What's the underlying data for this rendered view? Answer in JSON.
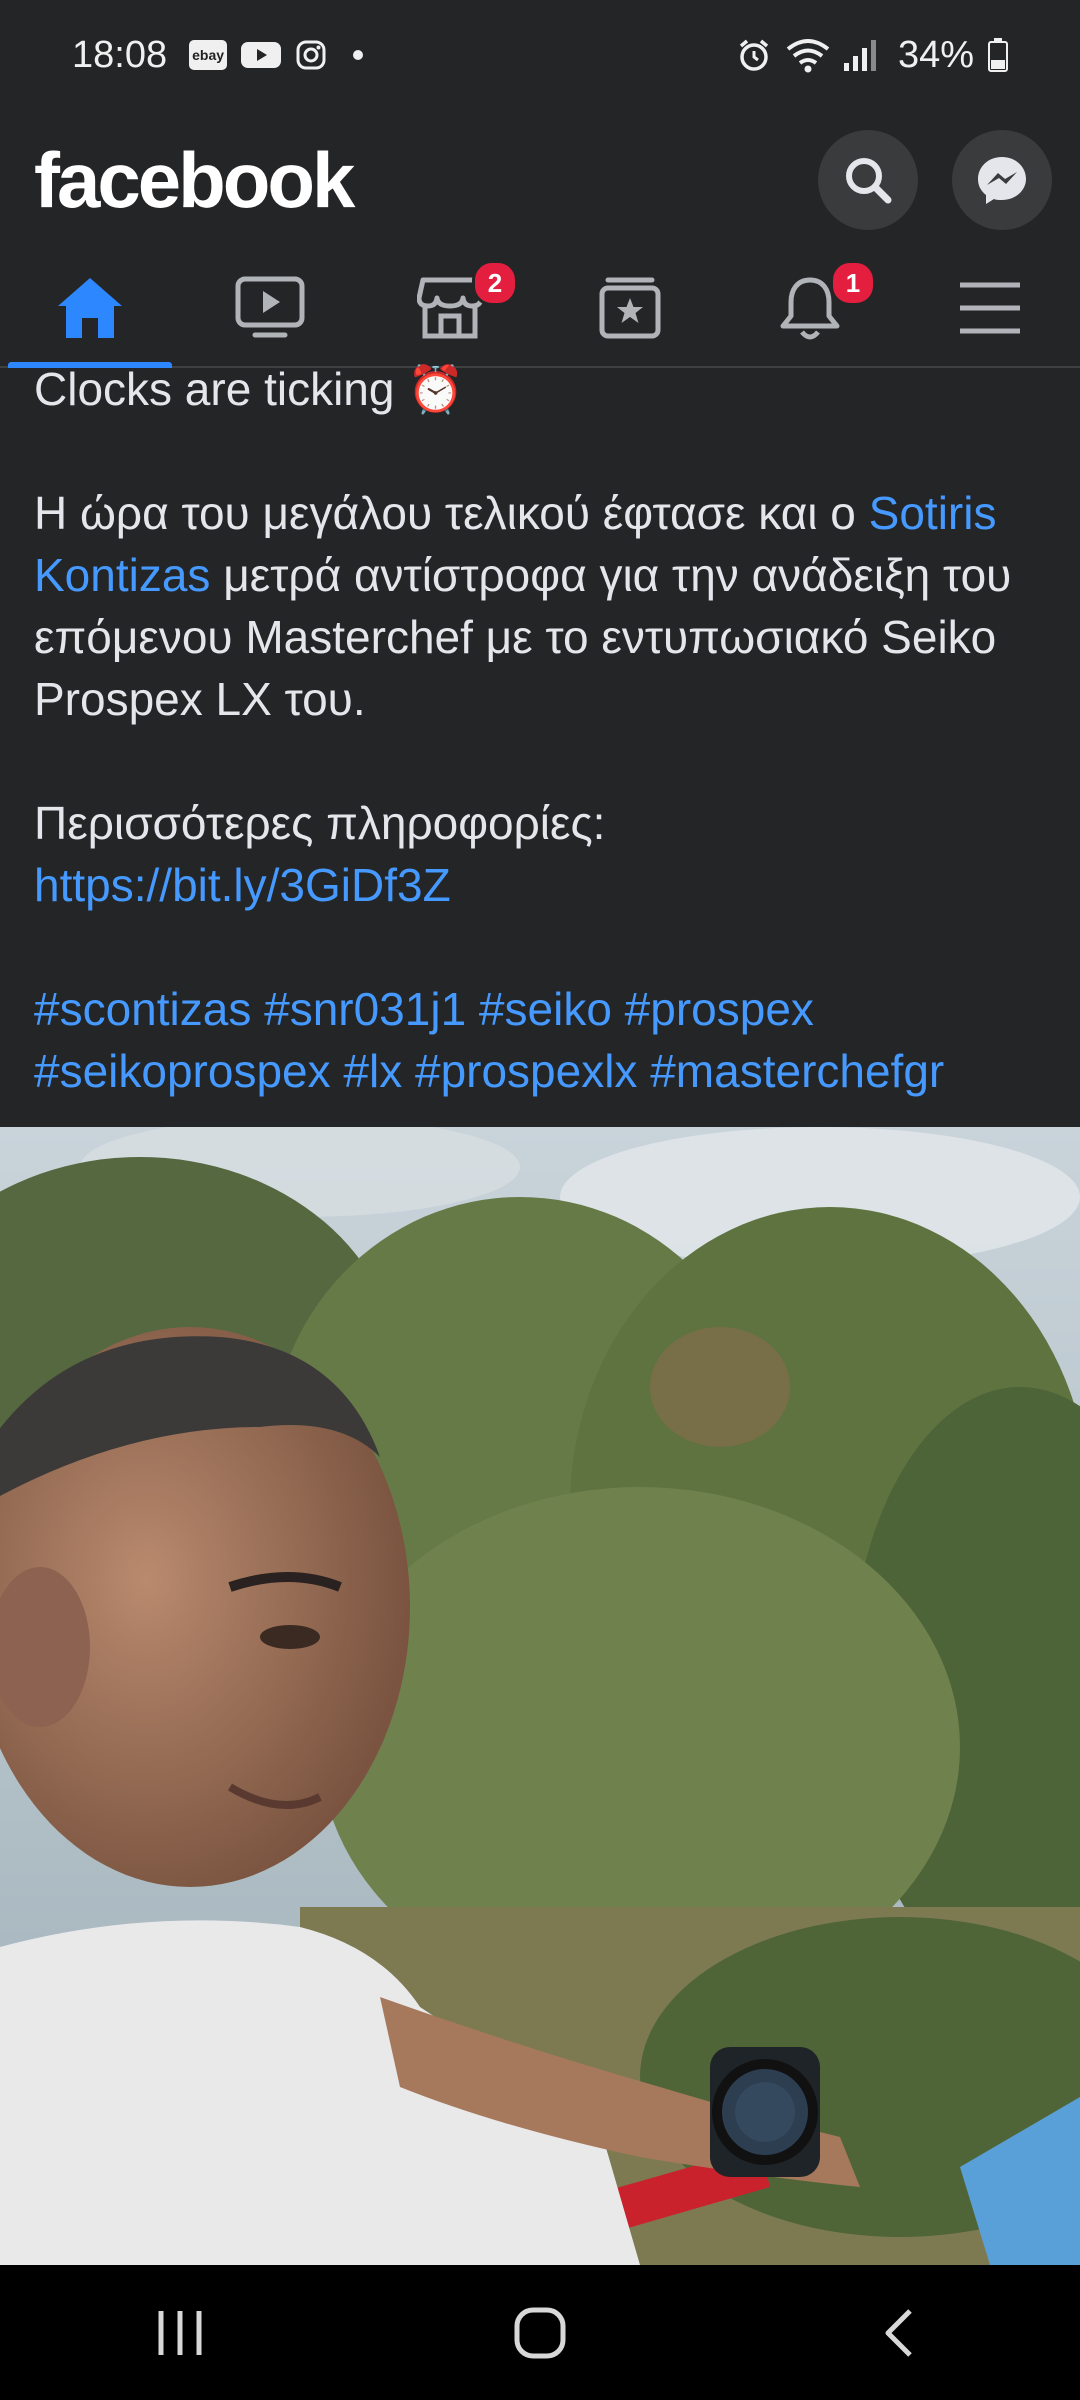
{
  "status_bar": {
    "time": "18:08",
    "ebay_label": "ebay",
    "battery": "34%"
  },
  "header": {
    "logo": "facebook"
  },
  "tabs": [
    {
      "name": "home",
      "badge": ""
    },
    {
      "name": "watch",
      "badge": ""
    },
    {
      "name": "marketplace",
      "badge": "2"
    },
    {
      "name": "saved",
      "badge": ""
    },
    {
      "name": "notifications",
      "badge": "1"
    },
    {
      "name": "menu",
      "badge": ""
    }
  ],
  "post": {
    "line1": "Clocks are ticking ⏰",
    "para_intro": "Η ώρα του μεγάλου τελικού έφτασε και ο ",
    "mention": "Sotiris Kontizas",
    "para_rest": " μετρά αντίστροφα για την ανάδειξη του επόμενου Masterchef με το εντυπωσιακό Seiko Prospex LX του.",
    "more_info_label": "Περισσότερες πληροφορίες:",
    "url": "https://bit.ly/3GiDf3Z",
    "hashtags_line1": "#scontizas #snr031j1 #seiko #prospex",
    "hashtags_line2": "#seikoprospex #lx #prospexlx #masterchefgr"
  },
  "colors": {
    "background": "#242526",
    "accent": "#2d88ff",
    "link": "#4599ff",
    "badge": "#e41e3f"
  }
}
